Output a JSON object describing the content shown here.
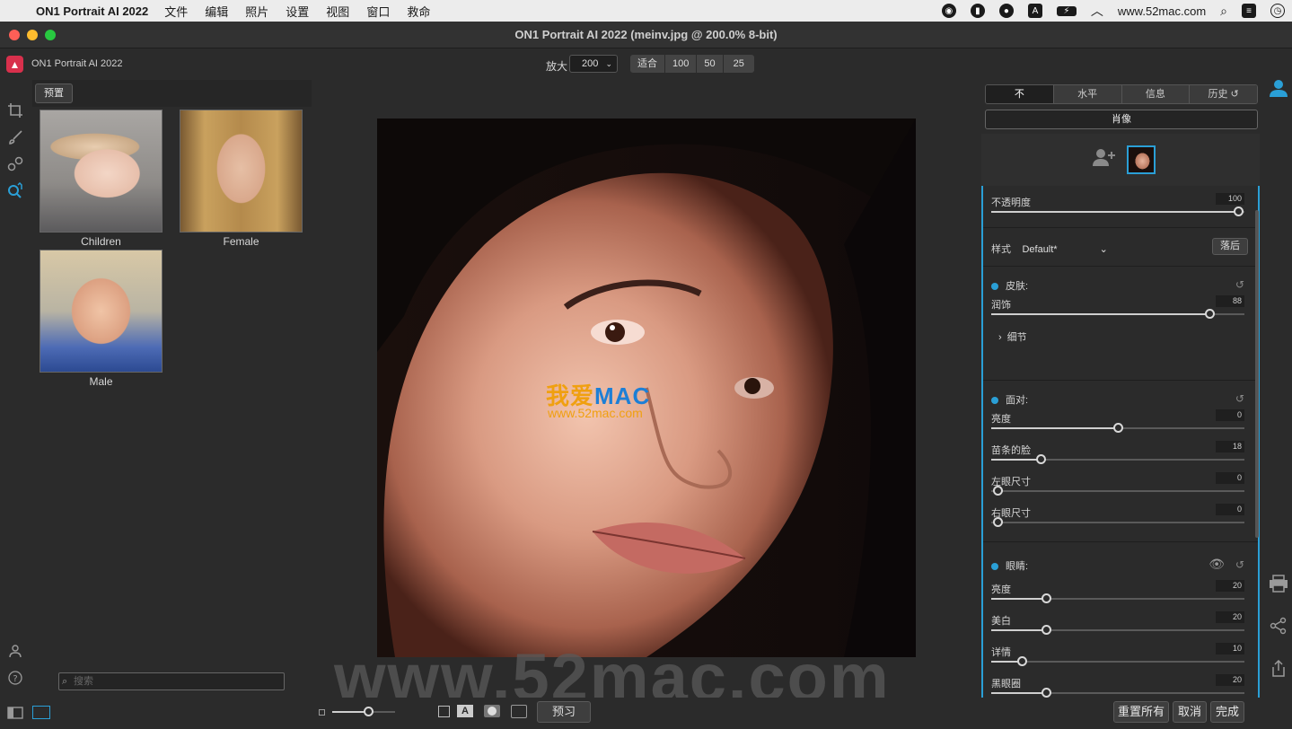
{
  "menubar": {
    "app_name": "ON1 Portrait AI 2022",
    "items": [
      "文件",
      "编辑",
      "照片",
      "设置",
      "视图",
      "窗口",
      "救命"
    ],
    "url": "www.52mac.com"
  },
  "window": {
    "title": "ON1 Portrait AI 2022 (meinv.jpg @ 200.0% 8-bit)"
  },
  "toolbar": {
    "app_name": "ON1 Portrait AI 2022",
    "zoom_label": "放大",
    "zoom_value": "200",
    "zoom_buttons": [
      "适合",
      "100",
      "50",
      "25"
    ]
  },
  "browser": {
    "preset_button": "预置",
    "thumbnails": [
      "Children",
      "Female",
      "Male"
    ],
    "search_placeholder": "搜索"
  },
  "canvas": {
    "watermark_text": "我爱",
    "watermark_brand": "MAC",
    "watermark_url": "www.52mac.com",
    "big_watermark": "www.52mac.com"
  },
  "bottom": {
    "preview_label": "预习",
    "reset_all": "重置所有",
    "cancel": "取消",
    "done": "完成"
  },
  "panel": {
    "tabs": [
      "不",
      "水平",
      "信息",
      "历史"
    ],
    "portrait_button": "肖像",
    "opacity": {
      "label": "不透明度",
      "value": 100
    },
    "style": {
      "label": "样式",
      "value": "Default*",
      "button": "落后"
    },
    "skin": {
      "title": "皮肤:",
      "smooth": {
        "label": "润饰",
        "value": 88
      },
      "detail": "细节"
    },
    "face": {
      "title": "面对:",
      "brightness": {
        "label": "亮度",
        "value": 0
      },
      "slim": {
        "label": "苗条的脸",
        "value": 18
      },
      "left_eye": {
        "label": "左眼尺寸",
        "value": 0
      },
      "right_eye": {
        "label": "右眼尺寸",
        "value": 0
      }
    },
    "eyes": {
      "title": "眼睛:",
      "brightness": {
        "label": "亮度",
        "value": 20
      },
      "whiten": {
        "label": "美白",
        "value": 20
      },
      "detail": {
        "label": "详情",
        "value": 10
      },
      "dark_circles": {
        "label": "黑眼圈",
        "value": 20
      }
    }
  },
  "colors": {
    "accent": "#2a9fd6",
    "logo": "#d8304c"
  }
}
